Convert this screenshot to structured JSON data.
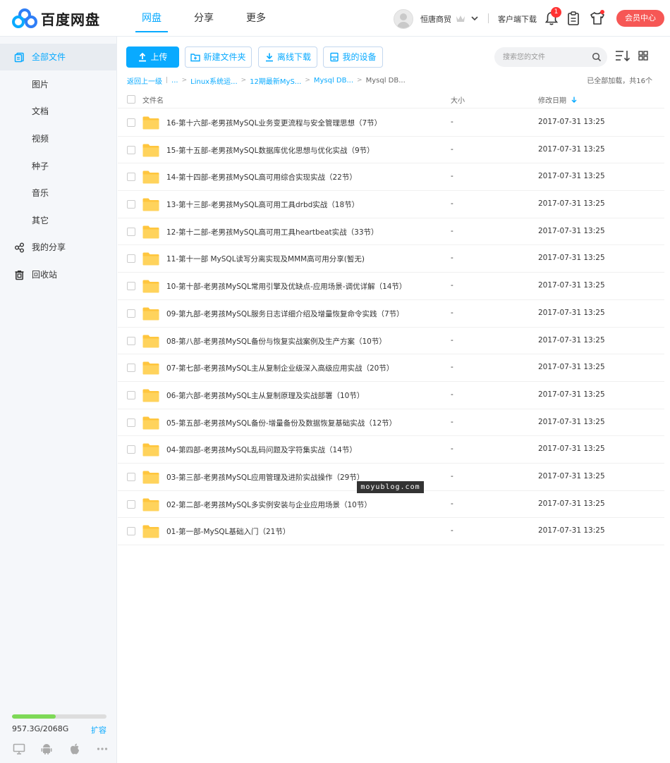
{
  "brand": {
    "name": "百度网盘",
    "colors": {
      "blue": "#09AAFF",
      "red": "#F65755",
      "green": "#7ED957"
    }
  },
  "nav": {
    "items": [
      {
        "label": "网盘"
      },
      {
        "label": "分享"
      },
      {
        "label": "更多"
      }
    ],
    "active": "网盘"
  },
  "header": {
    "user_name": "恒唐商贸",
    "client_download": "客户端下载",
    "notification_count": "1",
    "vip_center": "会员中心"
  },
  "sidebar": {
    "items": [
      {
        "label": "全部文件",
        "icon": "files-icon"
      },
      {
        "label": "图片"
      },
      {
        "label": "文档"
      },
      {
        "label": "视频"
      },
      {
        "label": "种子"
      },
      {
        "label": "音乐"
      },
      {
        "label": "其它"
      },
      {
        "label": "我的分享",
        "icon": "share-icon"
      },
      {
        "label": "回收站",
        "icon": "trash-icon"
      }
    ],
    "quota": {
      "text": "957.3G/2068G",
      "used_fraction": 0.463,
      "expand": "扩容"
    },
    "platforms": [
      "desktop-icon",
      "android-icon",
      "apple-icon",
      "more-icon"
    ]
  },
  "toolbar": {
    "upload": "上传",
    "new_folder": "新建文件夹",
    "offline_download": "离线下载",
    "my_devices": "我的设备",
    "search_placeholder": "搜索您的文件"
  },
  "breadcrumb": {
    "back": "返回上一级",
    "items": [
      "...",
      "Linux系统运...",
      "12期最新MyS...",
      "Mysql DB...",
      "Mysql DB..."
    ],
    "loaded_text": "已全部加载，共16个"
  },
  "table": {
    "columns": {
      "name": "文件名",
      "size": "大小",
      "date": "修改日期"
    },
    "rows": [
      {
        "name": "16-第十六部-老男孩MySQL业务变更流程与安全管理思想（7节）",
        "size": "-",
        "date": "2017-07-31 13:25"
      },
      {
        "name": "15-第十五部-老男孩MySQL数据库优化思想与优化实战（9节）",
        "size": "-",
        "date": "2017-07-31 13:25"
      },
      {
        "name": "14-第十四部-老男孩MySQL高可用综合实现实战（22节）",
        "size": "-",
        "date": "2017-07-31 13:25"
      },
      {
        "name": "13-第十三部-老男孩MySQL高可用工具drbd实战（18节）",
        "size": "-",
        "date": "2017-07-31 13:25"
      },
      {
        "name": "12-第十二部-老男孩MySQL高可用工具heartbeat实战（33节）",
        "size": "-",
        "date": "2017-07-31 13:25"
      },
      {
        "name": "11-第十一部 MySQL读写分离实现及MMM高可用分享(暂无)",
        "size": "-",
        "date": "2017-07-31 13:25"
      },
      {
        "name": "10-第十部-老男孩MySQL常用引擎及优缺点-应用场景-调优详解（14节）",
        "size": "-",
        "date": "2017-07-31 13:25"
      },
      {
        "name": "09-第九部-老男孩MySQL服务日志详细介绍及增量恢复命令实践（7节）",
        "size": "-",
        "date": "2017-07-31 13:25"
      },
      {
        "name": "08-第八部-老男孩MySQL备份与恢复实战案例及生产方案（10节）",
        "size": "-",
        "date": "2017-07-31 13:25"
      },
      {
        "name": "07-第七部-老男孩MySQL主从复制企业级深入高级应用实战（20节）",
        "size": "-",
        "date": "2017-07-31 13:25"
      },
      {
        "name": "06-第六部-老男孩MySQL主从复制原理及实战部署（10节）",
        "size": "-",
        "date": "2017-07-31 13:25"
      },
      {
        "name": "05-第五部-老男孩MySQL备份-增量备份及数据恢复基础实战（12节）",
        "size": "-",
        "date": "2017-07-31 13:25"
      },
      {
        "name": "04-第四部-老男孩MySQL乱码问题及字符集实战（14节）",
        "size": "-",
        "date": "2017-07-31 13:25"
      },
      {
        "name": "03-第三部-老男孩MySQL应用管理及进阶实战操作（29节）",
        "size": "-",
        "date": "2017-07-31 13:25"
      },
      {
        "name": "02-第二部-老男孩MySQL多实例安装与企业应用场景（10节）",
        "size": "-",
        "date": "2017-07-31 13:25"
      },
      {
        "name": "01-第一部-MySQL基础入门（21节）",
        "size": "-",
        "date": "2017-07-31 13:25"
      }
    ]
  },
  "watermark": "moyublog.com"
}
